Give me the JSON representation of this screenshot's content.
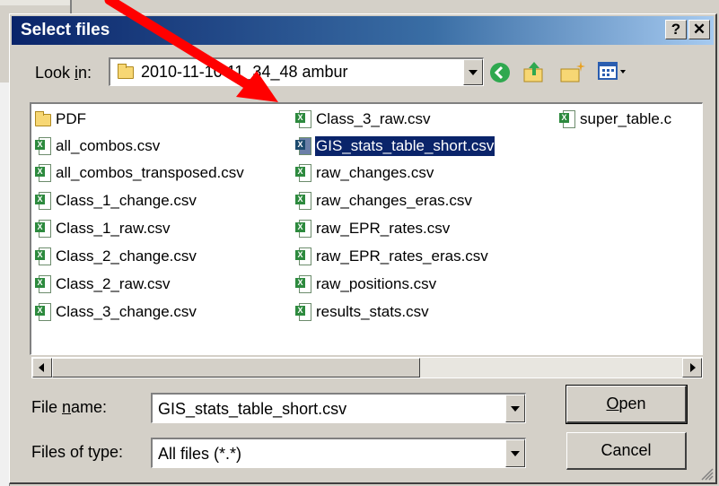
{
  "dialog": {
    "title": "Select files",
    "help_label": "?",
    "close_label": "✕"
  },
  "lookin": {
    "label_prefix": "Look ",
    "label_access": "i",
    "label_suffix": "n:",
    "value": "2010-11-10 11_34_48 ambur"
  },
  "toolbar": {
    "icons": [
      "back-icon",
      "up-folder-icon",
      "new-folder-icon",
      "view-menu-icon"
    ]
  },
  "files": {
    "col1": [
      "PDF",
      "all_combos.csv",
      "all_combos_transposed.csv",
      "Class_1_change.csv",
      "Class_1_raw.csv",
      "Class_2_change.csv",
      "Class_2_raw.csv",
      "Class_3_change.csv"
    ],
    "col2": [
      "Class_3_raw.csv",
      "GIS_stats_table_short.csv",
      "raw_changes.csv",
      "raw_changes_eras.csv",
      "raw_EPR_rates.csv",
      "raw_EPR_rates_eras.csv",
      "raw_positions.csv",
      "results_stats.csv"
    ],
    "col3": [
      "super_table.c"
    ],
    "selected": "GIS_stats_table_short.csv"
  },
  "filename": {
    "label_prefix": "File ",
    "label_access": "n",
    "label_suffix": "ame:",
    "value": "GIS_stats_table_short.csv"
  },
  "filetype": {
    "label": "Files of type:",
    "value": "All files (*.*)"
  },
  "buttons": {
    "open_access": "O",
    "open_rest": "pen",
    "cancel": "Cancel"
  },
  "annotation": {
    "color": "#ff0000"
  }
}
